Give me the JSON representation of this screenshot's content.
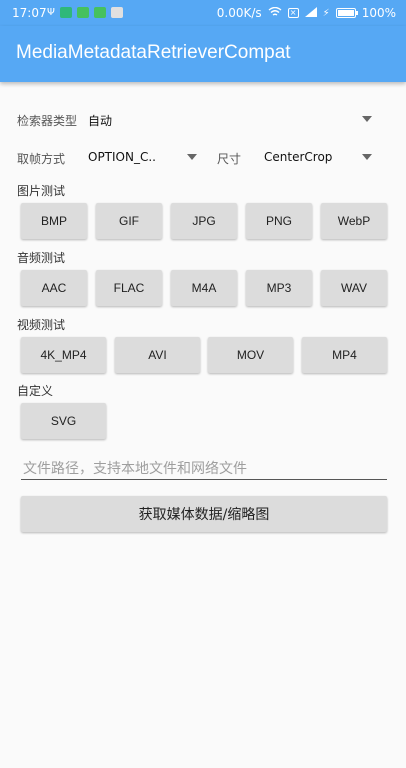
{
  "status_bar": {
    "time": "17:07",
    "network_speed": "0.00K/s",
    "battery": "100%",
    "icons_left": [
      "usb-icon",
      "sim-icon",
      "app-icon-green",
      "app-icon-green-2",
      "notification-icon"
    ],
    "icons_right": [
      "wifi-icon",
      "sim-x-icon",
      "signal-icon",
      "battery-icon"
    ]
  },
  "app_bar": {
    "title": "MediaMetadataRetrieverCompat",
    "color": "#56a8f4"
  },
  "form": {
    "retriever_type_label": "检索器类型",
    "retriever_type_value": "自动",
    "frame_mode_label": "取帧方式",
    "frame_mode_value": "OPTION_C..",
    "size_label": "尺寸",
    "size_value": "CenterCrop"
  },
  "sections": {
    "image": {
      "title": "图片测试",
      "buttons": [
        "BMP",
        "GIF",
        "JPG",
        "PNG",
        "WebP"
      ]
    },
    "audio": {
      "title": "音频测试",
      "buttons": [
        "AAC",
        "FLAC",
        "M4A",
        "MP3",
        "WAV"
      ]
    },
    "video": {
      "title": "视频测试",
      "buttons": [
        "4K_MP4",
        "AVI",
        "MOV",
        "MP4"
      ]
    },
    "custom": {
      "title": "自定义",
      "buttons": [
        "SVG"
      ]
    }
  },
  "path_input": {
    "placeholder": "文件路径，支持本地文件和网络文件",
    "value": ""
  },
  "main_button": {
    "label": "获取媒体数据/缩略图"
  }
}
